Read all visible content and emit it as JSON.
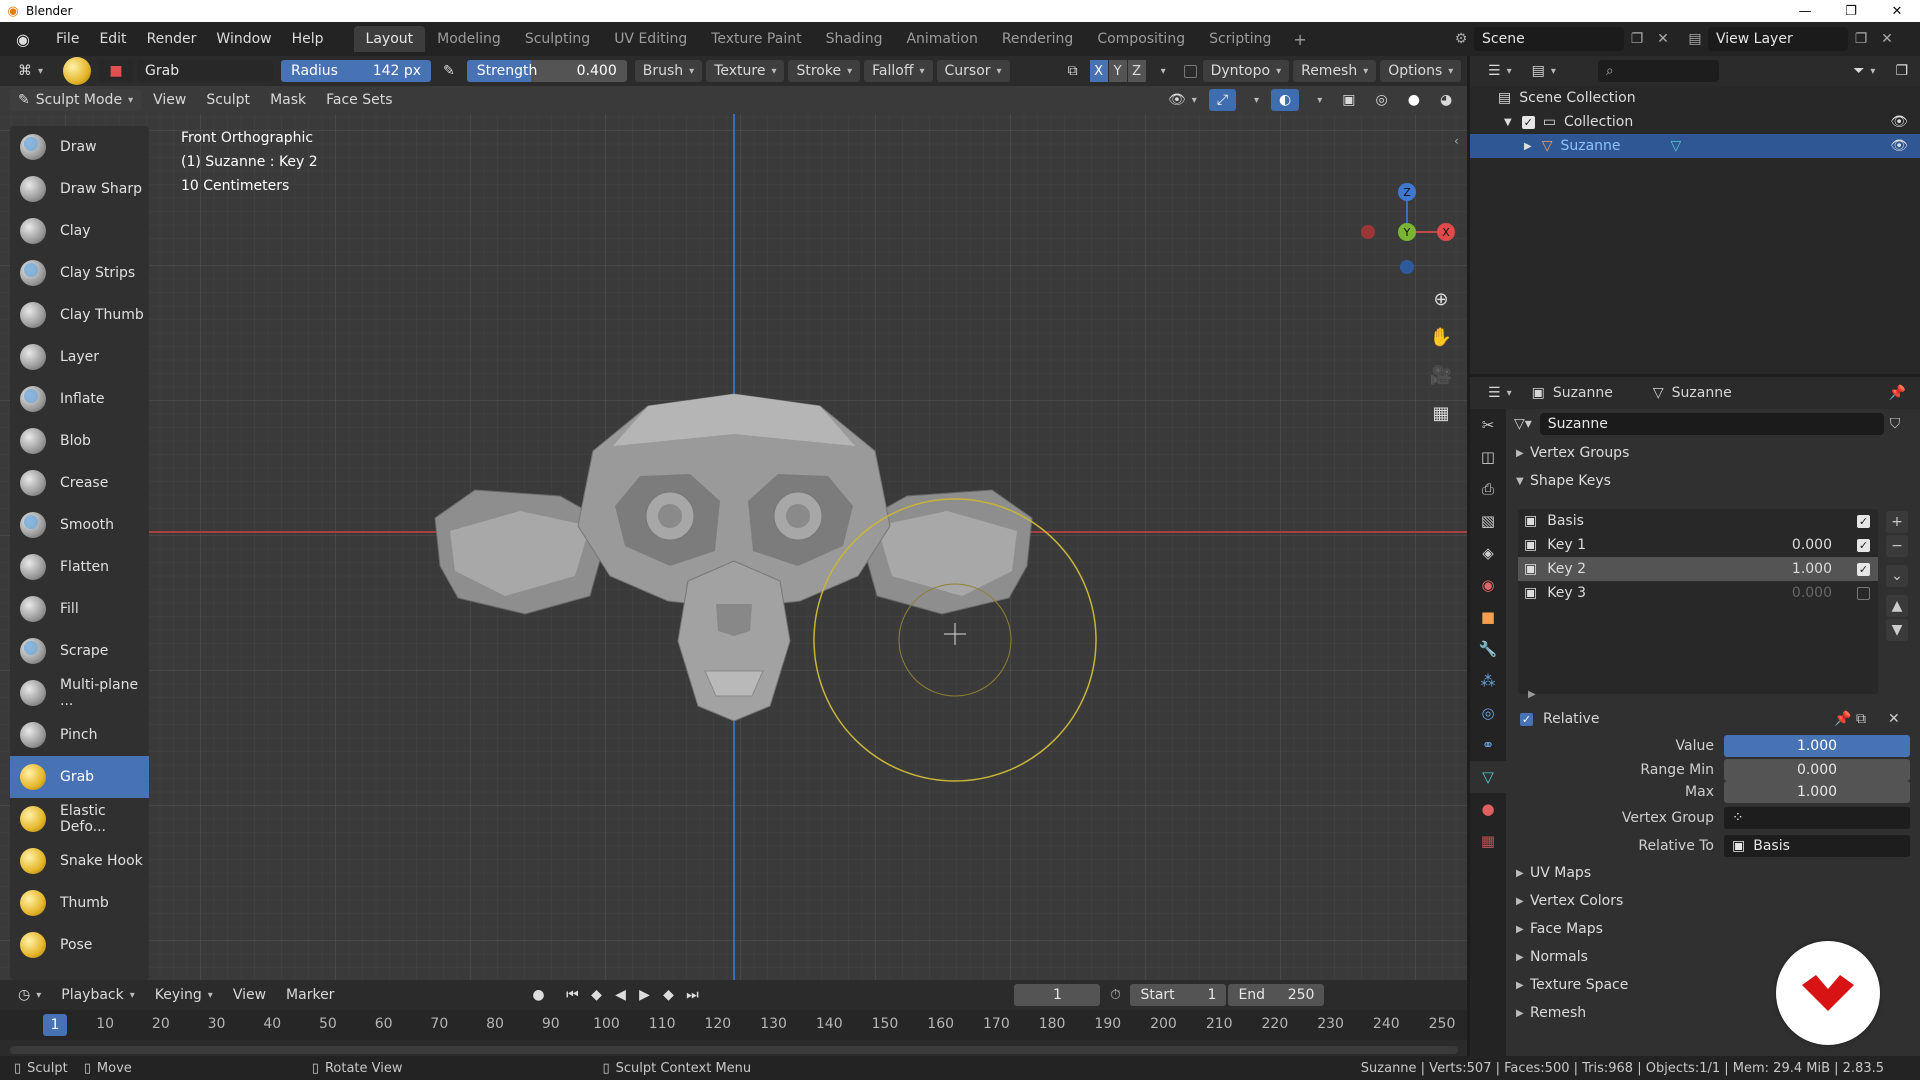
{
  "window": {
    "title": "Blender"
  },
  "menu": [
    "File",
    "Edit",
    "Render",
    "Window",
    "Help"
  ],
  "workspaces": [
    "Layout",
    "Modeling",
    "Sculpting",
    "UV Editing",
    "Texture Paint",
    "Shading",
    "Animation",
    "Rendering",
    "Compositing",
    "Scripting"
  ],
  "active_workspace": "Layout",
  "scene": {
    "name": "Scene",
    "view_layer": "View Layer"
  },
  "tool_header": {
    "brush_name": "Grab",
    "radius_label": "Radius",
    "radius_value": "142 px",
    "strength_label": "Strength",
    "strength_value": "0.400",
    "strength_fraction": 0.4,
    "dropdowns": [
      "Brush",
      "Texture",
      "Stroke",
      "Falloff",
      "Cursor"
    ],
    "axes": [
      "X",
      "Y",
      "Z"
    ],
    "dyntopo": "Dyntopo",
    "remesh": "Remesh",
    "options": "Options"
  },
  "view_header": {
    "mode": "Sculpt Mode",
    "menus": [
      "View",
      "Sculpt",
      "Mask",
      "Face Sets"
    ]
  },
  "tools": [
    {
      "label": "Draw"
    },
    {
      "label": "Draw Sharp"
    },
    {
      "label": "Clay"
    },
    {
      "label": "Clay Strips"
    },
    {
      "label": "Clay Thumb"
    },
    {
      "label": "Layer"
    },
    {
      "label": "Inflate"
    },
    {
      "label": "Blob"
    },
    {
      "label": "Crease"
    },
    {
      "label": "Smooth"
    },
    {
      "label": "Flatten"
    },
    {
      "label": "Fill"
    },
    {
      "label": "Scrape"
    },
    {
      "label": "Multi-plane ..."
    },
    {
      "label": "Pinch"
    },
    {
      "label": "Grab"
    },
    {
      "label": "Elastic Defo..."
    },
    {
      "label": "Snake Hook"
    },
    {
      "label": "Thumb"
    },
    {
      "label": "Pose"
    }
  ],
  "active_tool": "Grab",
  "viewport_info": {
    "view": "Front Orthographic",
    "object": "(1) Suzanne : Key 2",
    "scale": "10 Centimeters"
  },
  "gizmo": {
    "z": "Z",
    "y": "Y",
    "x": "X"
  },
  "timeline": {
    "menus": [
      "Playback",
      "Keying",
      "View",
      "Marker"
    ],
    "current_frame": "1",
    "start_label": "Start",
    "start": "1",
    "end_label": "End",
    "end": "250",
    "ticks": [
      "1",
      "10",
      "20",
      "30",
      "40",
      "50",
      "60",
      "70",
      "80",
      "90",
      "100",
      "110",
      "120",
      "130",
      "140",
      "150",
      "160",
      "170",
      "180",
      "190",
      "200",
      "210",
      "220",
      "230",
      "240",
      "250"
    ]
  },
  "status": {
    "mode": "Sculpt",
    "move": "Move",
    "rotate": "Rotate View",
    "context": "Sculpt Context Menu",
    "stats": "Suzanne | Verts:507 | Faces:500 | Tris:968 | Objects:1/1 | Mem: 29.4 MiB | 2.83.5"
  },
  "outliner": {
    "root": "Scene Collection",
    "collection": "Collection",
    "object": "Suzanne"
  },
  "properties": {
    "object_name": "Suzanne",
    "mesh_name": "Suzanne",
    "data_name": "Suzanne",
    "vertex_groups": "Vertex Groups",
    "shape_keys": "Shape Keys",
    "keys": [
      {
        "name": "Basis",
        "value": "",
        "enabled": true
      },
      {
        "name": "Key 1",
        "value": "0.000",
        "enabled": true
      },
      {
        "name": "Key 2",
        "value": "1.000",
        "enabled": true
      },
      {
        "name": "Key 3",
        "value": "0.000",
        "enabled": false
      }
    ],
    "relative_label": "Relative",
    "value_label": "Value",
    "value": "1.000",
    "range_min_label": "Range Min",
    "range_min": "0.000",
    "max_label": "Max",
    "max": "1.000",
    "vertex_group_label": "Vertex Group",
    "relative_to_label": "Relative To",
    "relative_to": "Basis",
    "collapsed_panels": [
      "UV Maps",
      "Vertex Colors",
      "Face Maps",
      "Normals",
      "Texture Space",
      "Remesh"
    ]
  },
  "colors": {
    "accent": "#4772b3",
    "brush_circle": "#c9b43a",
    "x_axis": "#a8403f",
    "z_axis": "#3e6db0"
  }
}
